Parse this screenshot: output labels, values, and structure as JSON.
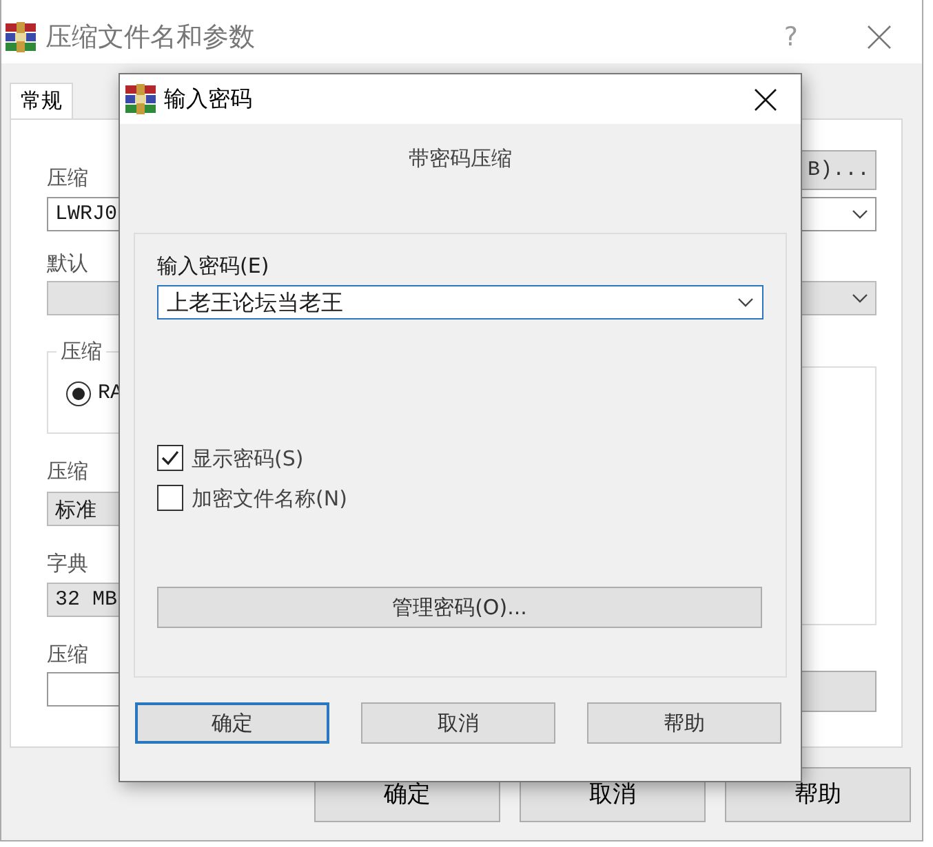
{
  "window": {
    "title": "压缩文件名和参数",
    "help_button": "?"
  },
  "tabs": [
    {
      "label": "常规",
      "selected": true
    }
  ],
  "general": {
    "archive_name_label": "压缩",
    "browse_button": "B)...",
    "archive_name_value": "LWRJ0",
    "default_profile_label": "默认",
    "format_group": {
      "title": "压缩",
      "options": [
        {
          "label": "RA",
          "selected": true
        }
      ]
    },
    "method_label": "压缩",
    "method_value": "标准",
    "dictionary_label": "字典",
    "dictionary_value": "32 MB",
    "split_label": "压缩"
  },
  "buttons": [
    "确定",
    "取消",
    "帮助"
  ],
  "dialog": {
    "title": "输入密码",
    "heading": "带密码压缩",
    "password_label": "输入密码(E)",
    "password_value": "上老王论坛当老王",
    "options": [
      {
        "label": "显示密码(S)",
        "checked": true
      },
      {
        "label": "加密文件名称(N)",
        "checked": false
      }
    ],
    "manage_button": "管理密码(O)...",
    "buttons": [
      {
        "label": "确定",
        "default": true
      },
      {
        "label": "取消",
        "default": false
      },
      {
        "label": "帮助",
        "default": false
      }
    ]
  }
}
